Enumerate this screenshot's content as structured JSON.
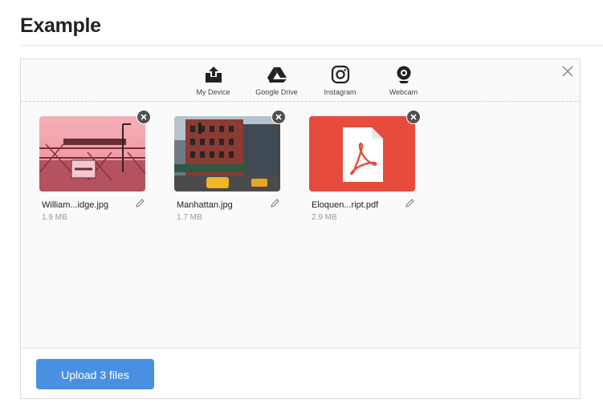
{
  "page": {
    "title": "Example"
  },
  "toolbar": {
    "sources": [
      {
        "label": "My Device",
        "icon": "upload-tray-icon"
      },
      {
        "label": "Google Drive",
        "icon": "google-drive-icon"
      },
      {
        "label": "Instagram",
        "icon": "instagram-icon"
      },
      {
        "label": "Webcam",
        "icon": "webcam-icon"
      }
    ],
    "close_icon": "close-icon"
  },
  "files": [
    {
      "name": "William...idge.jpg",
      "size": "1.9 MB",
      "thumbnail": "bridge-photo"
    },
    {
      "name": "Manhattan.jpg",
      "size": "1.7 MB",
      "thumbnail": "street-photo"
    },
    {
      "name": "Eloquen...ript.pdf",
      "size": "2.9 MB",
      "thumbnail": "pdf-icon"
    }
  ],
  "footer": {
    "upload_label": "Upload 3 files"
  },
  "colors": {
    "accent": "#4a90e2",
    "pdf": "#e64b3c"
  }
}
